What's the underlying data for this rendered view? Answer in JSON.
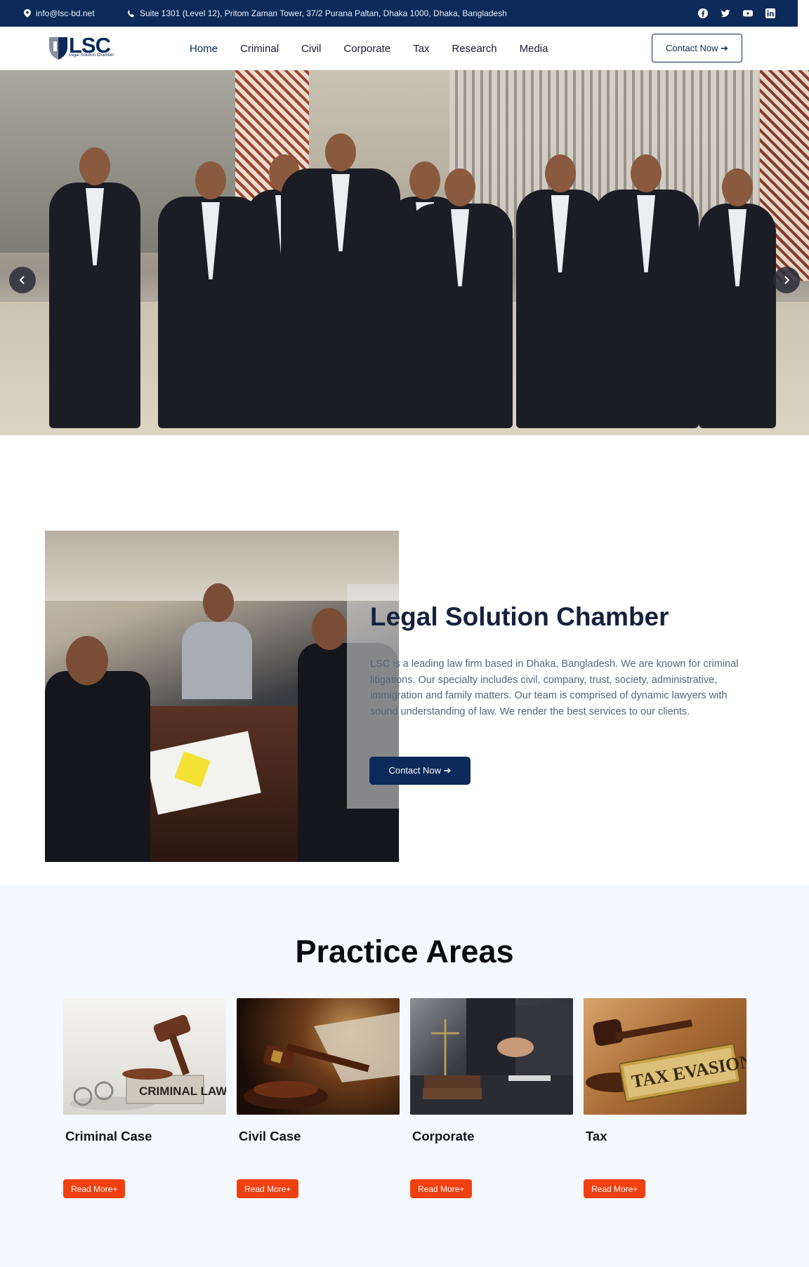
{
  "topbar": {
    "email": "info@lsc-bd.net",
    "address": "Suite 1301 (Level 12), Pritom Zaman Tower, 37/2 Purana Paltan, Dhaka 1000, Dhaka, Bangladesh",
    "socials": [
      "facebook-icon",
      "twitter-icon",
      "youtube-icon",
      "linkedin-icon"
    ]
  },
  "header": {
    "logo_text": "LSC",
    "logo_sub": "Legal Solution Chamber",
    "nav": [
      "Home",
      "Criminal",
      "Civil",
      "Corporate",
      "Tax",
      "Research",
      "Media"
    ],
    "active_nav": "Home",
    "cta": "Contact Now ➔"
  },
  "about": {
    "title": "Legal Solution Chamber",
    "text": "LSC is a leading law firm based in Dhaka, Bangladesh. We are known for criminal litigations. Our specialty includes civil, company, trust, society, administrative, immigration and family matters. Our team is comprised of dynamic lawyers with sound understanding of law. We render the best services to our clients.",
    "cta": "Contact Now ➔"
  },
  "practice": {
    "title": "Practice Areas",
    "cards": [
      {
        "title": "Criminal Case",
        "button": "Read More+",
        "image_label": "CRIMINAL LAW"
      },
      {
        "title": "Civil Case",
        "button": "Read More+"
      },
      {
        "title": "Corporate",
        "button": "Read More+"
      },
      {
        "title": "Tax",
        "button": "Read More+",
        "image_label": "TAX EVASION"
      }
    ]
  },
  "colors": {
    "navy": "#0b2a5a",
    "accent_orange": "#f0400f",
    "section_bg": "#f5f8fc"
  }
}
